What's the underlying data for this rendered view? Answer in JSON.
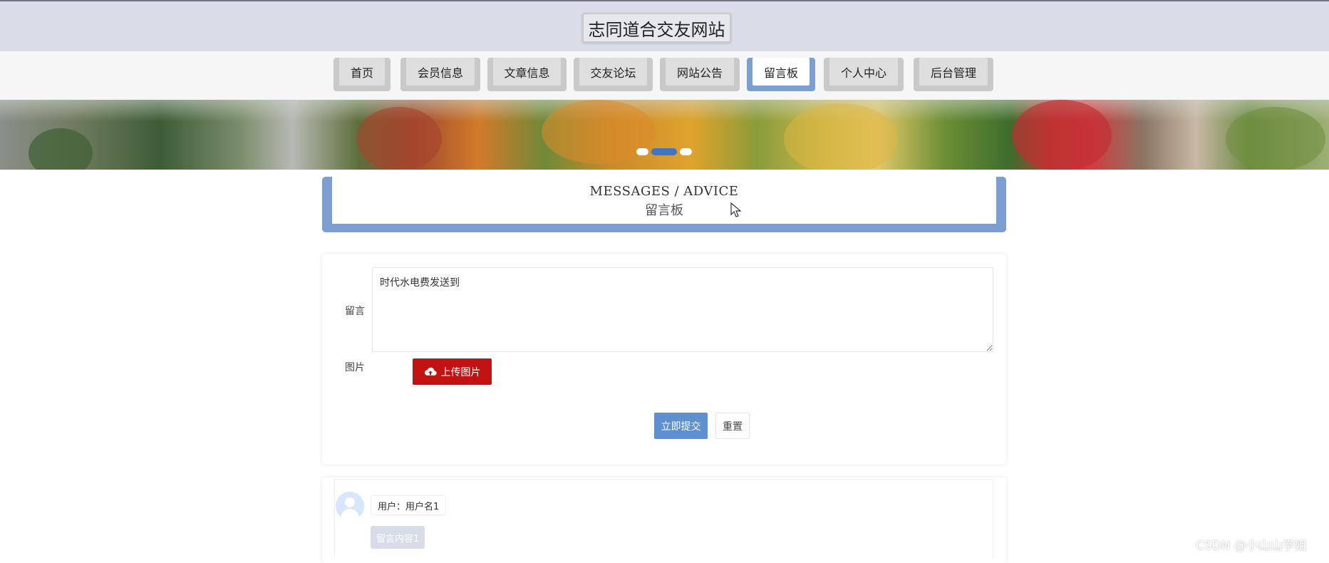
{
  "header": {
    "site_title": "志同道合交友网站"
  },
  "nav": {
    "items": [
      {
        "label": "首页",
        "active": false
      },
      {
        "label": "会员信息",
        "active": false
      },
      {
        "label": "文章信息",
        "active": false
      },
      {
        "label": "交友论坛",
        "active": false
      },
      {
        "label": "网站公告",
        "active": false
      },
      {
        "label": "留言板",
        "active": true
      },
      {
        "label": "个人中心",
        "active": false
      },
      {
        "label": "后台管理",
        "active": false
      }
    ]
  },
  "banner": {
    "slide_count": 3,
    "active_slide": 2
  },
  "section": {
    "title_en": "MESSAGES / ADVICE",
    "title_cn": "留言板"
  },
  "form": {
    "message_label": "留言",
    "message_value": "时代水电费发送到",
    "image_label": "图片",
    "upload_label": "上传图片",
    "submit_label": "立即提交",
    "reset_label": "重置"
  },
  "messages": [
    {
      "user": "用户：用户名1",
      "content": "留言内容1"
    }
  ],
  "watermark": "CSDN @小山山学姐",
  "colors": {
    "accent": "#7b9fd0",
    "upload": "#c31212",
    "submit": "#5e8fd0",
    "header_bg": "#d8dde8"
  }
}
